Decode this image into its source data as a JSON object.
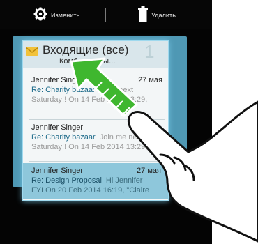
{
  "toolbar": {
    "edit_label": "Изменить",
    "delete_label": "Удалить"
  },
  "background_widget": {
    "title": "Входящие (все)",
    "count": "1"
  },
  "widget": {
    "title": "Входящие (все)",
    "count": "1",
    "subtitle": "Комб... данны..."
  },
  "messages": [
    {
      "from": "Jennifer Singer",
      "date": "27 мая",
      "subject": "Re: Charity bazaar",
      "snippet": "...me next",
      "preview": "Saturday!! On 14 Feb 2014 13:29,"
    },
    {
      "from": "Jennifer Singer",
      "date": "",
      "subject": "Re: Charity bazaar",
      "snippet": "Join me next",
      "preview": "Saturday!! On 14 Feb 2014 13:29,"
    },
    {
      "from": "Jennifer Singer",
      "date": "27 мая",
      "subject": "Re: Design Proposal",
      "snippet": "Hi Jennifer",
      "preview": "FYI On 20 Feb 2014 16:19, \"Claire"
    }
  ],
  "icons": {
    "edit": "gear-icon",
    "delete": "trash-icon",
    "mail": "mail-icon",
    "arrow": "drag-arrow-icon",
    "hand": "pointing-hand-icon"
  },
  "colors": {
    "highlight": "#58a9c8",
    "arrow": "#3fb72f",
    "accent_text": "#1e6b8a"
  }
}
